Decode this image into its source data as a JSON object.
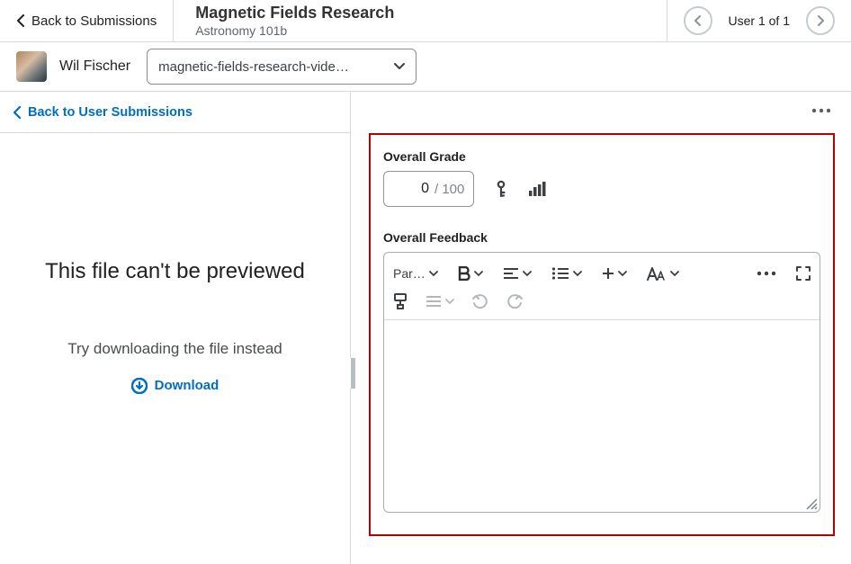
{
  "header": {
    "back_label": "Back to Submissions",
    "assignment_title": "Magnetic Fields Research",
    "course_name": "Astronomy 101b",
    "user_counter": "User 1 of 1"
  },
  "subheader": {
    "student_name": "Wil Fischer",
    "file_selected": "magnetic-fields-research-vide…"
  },
  "left": {
    "back_user_submissions": "Back to User Submissions",
    "preview_message": "This file can't be previewed",
    "preview_hint": "Try downloading the file instead",
    "download_label": "Download"
  },
  "grading": {
    "overall_grade_label": "Overall Grade",
    "grade_value": "0",
    "grade_max": "/ 100",
    "overall_feedback_label": "Overall Feedback"
  },
  "editor": {
    "paragraph_label": "Par…"
  }
}
